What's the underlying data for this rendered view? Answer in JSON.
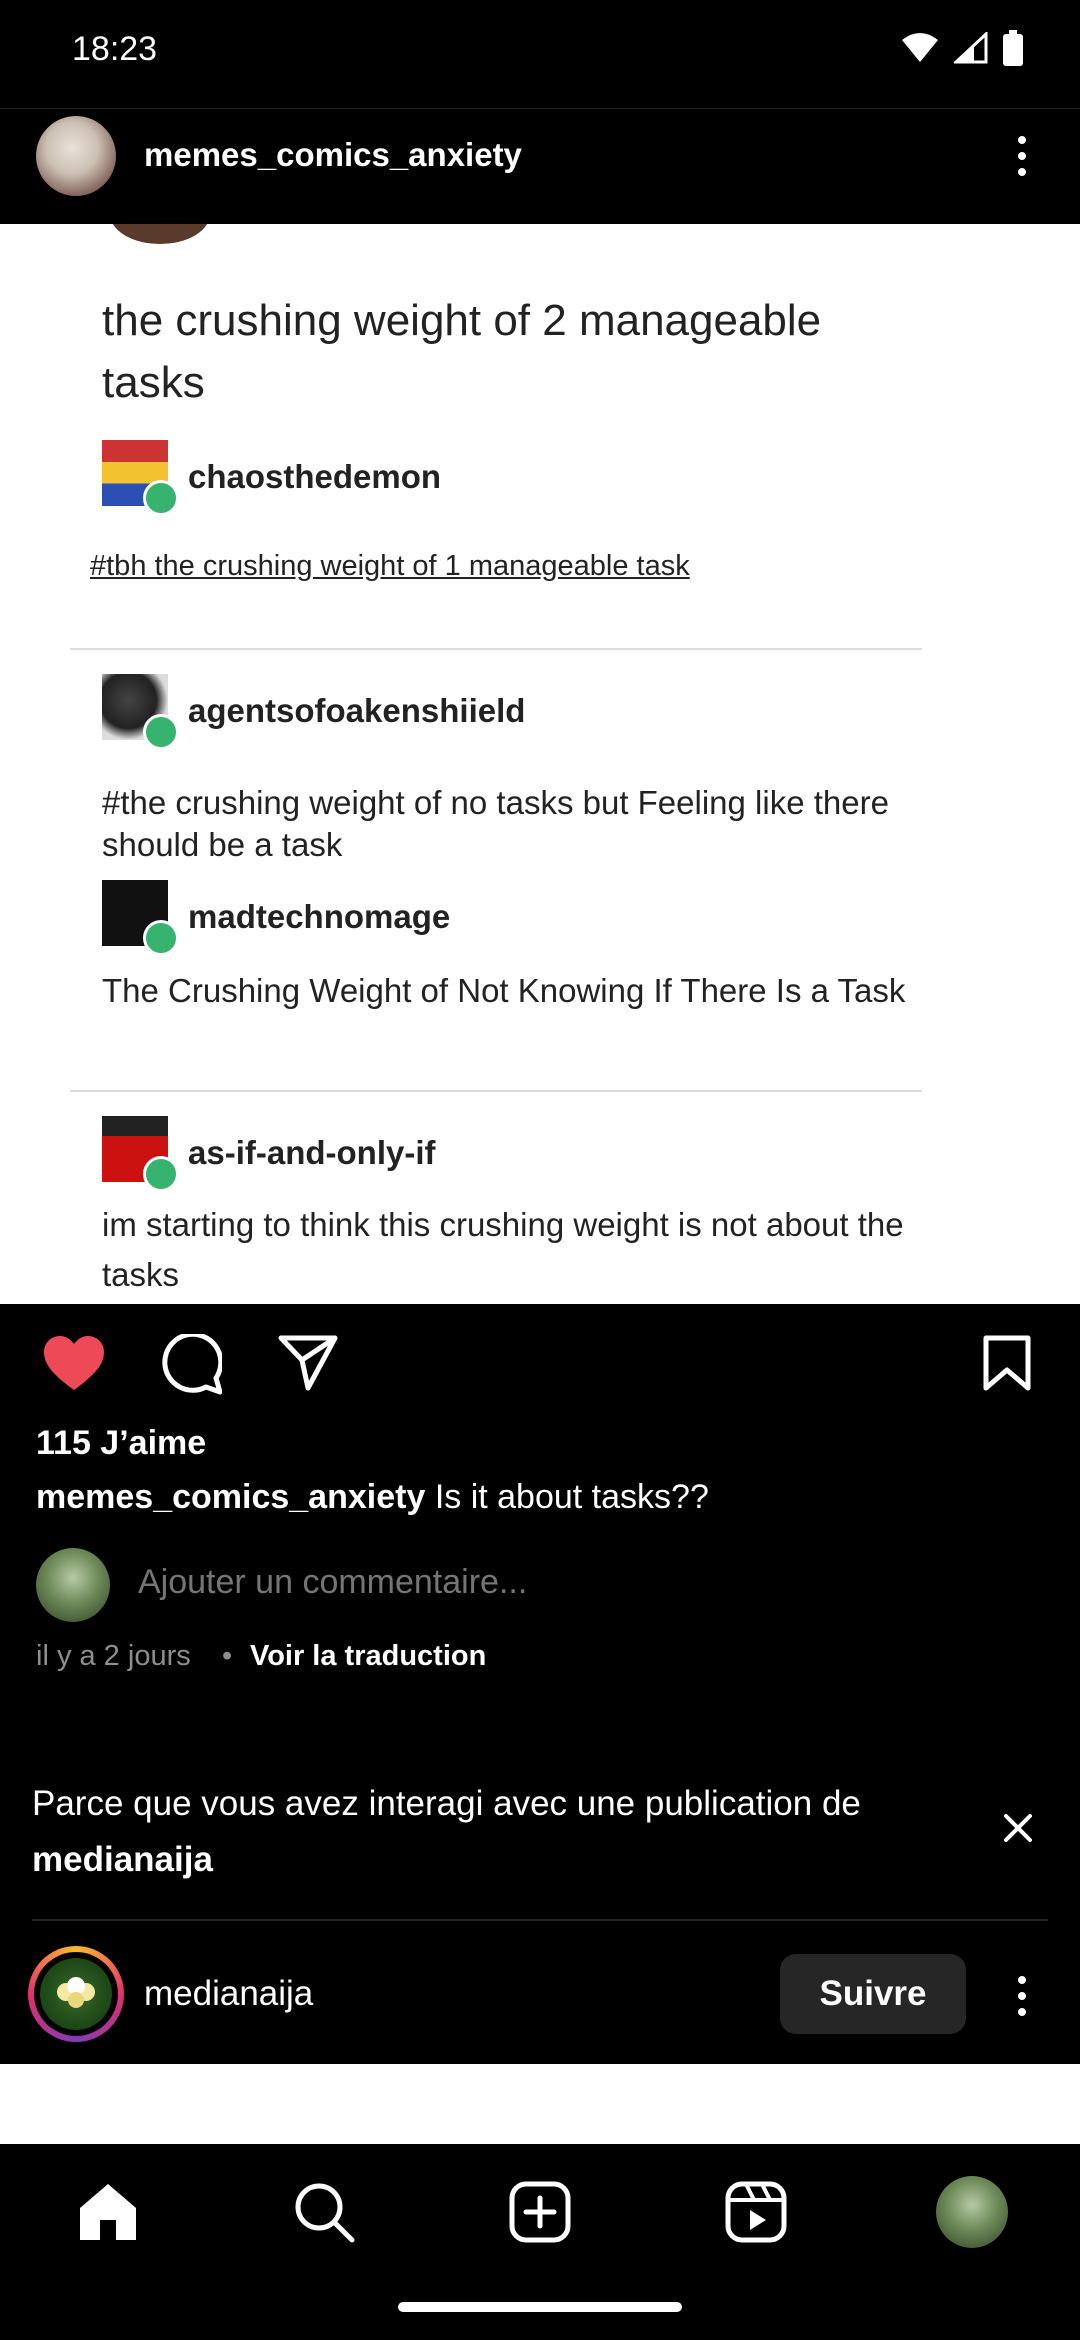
{
  "status_bar": {
    "time": "18:23"
  },
  "post": {
    "username": "memes_comics_anxiety",
    "image": {
      "title": "the crushing weight of 2 manageable tasks",
      "reblogs": [
        {
          "user": "chaosthedemon",
          "text": "#tbh the crushing weight of 1 manageable task"
        },
        {
          "user": "agentsofoakenshiield",
          "text": "#the crushing weight of no tasks but Feeling like there should be a task"
        },
        {
          "user": "madtechnomage",
          "text": "The Crushing Weight of Not Knowing If There Is a Task"
        },
        {
          "user": "as-if-and-only-if",
          "text": "im starting to think this crushing weight is not about the tasks"
        }
      ]
    },
    "likes": "115 J’aime",
    "caption_user": "memes_comics_anxiety",
    "caption_text": "Is it about tasks??",
    "comment_placeholder": "Ajouter un commentaire...",
    "time_ago": "il y a 2 jours",
    "separator": "•",
    "translate_label": "Voir la traduction"
  },
  "suggestion": {
    "text": "Parce que vous avez interagi avec une publication de",
    "source_user": "medianaija",
    "next_user": "medianaija",
    "follow_label": "Suivre"
  },
  "colors": {
    "like": "#ed4956",
    "follow_bg": "#262626",
    "muted": "#8e8e8e"
  },
  "icons": [
    "heart-icon",
    "comment-icon",
    "share-icon",
    "bookmark-icon",
    "home-icon",
    "search-icon",
    "create-icon",
    "reels-icon"
  ]
}
